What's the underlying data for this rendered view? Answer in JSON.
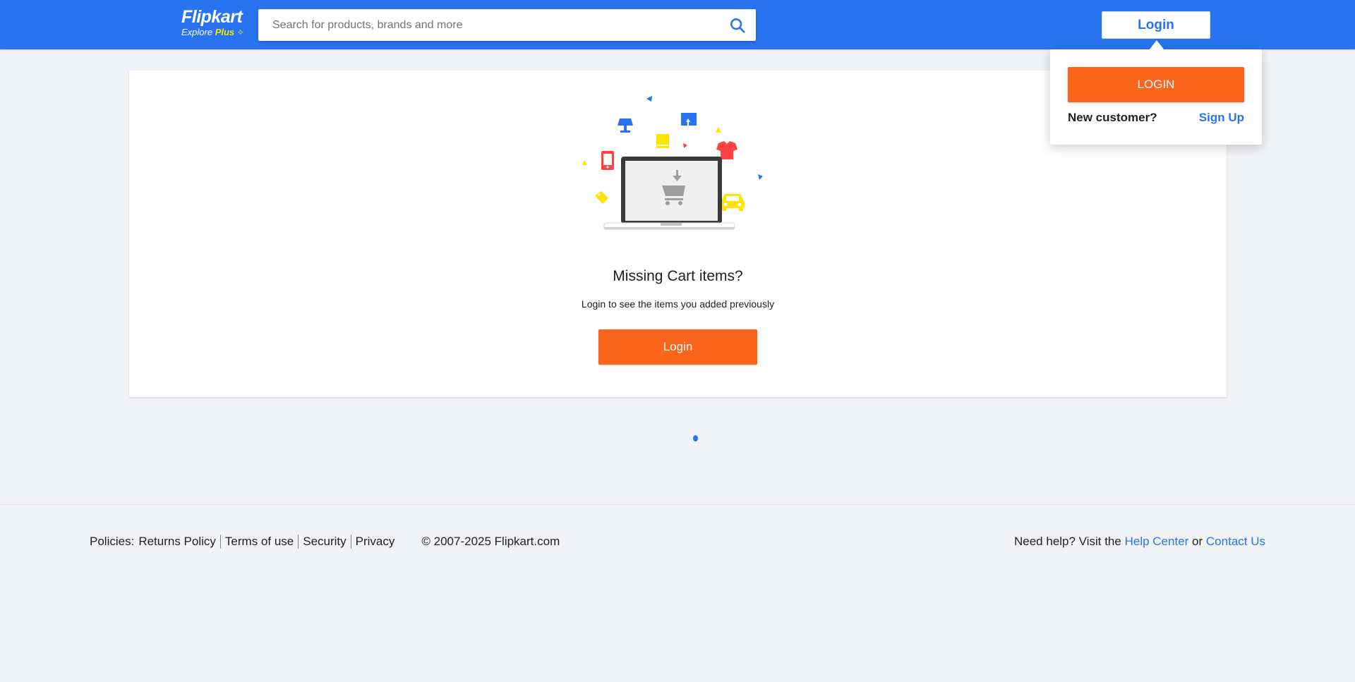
{
  "header": {
    "logo_text": "Flipkart",
    "logo_sub_prefix": "Explore",
    "logo_sub_plus": "Plus",
    "search_placeholder": "Search for products, brands and more",
    "login_label": "Login"
  },
  "login_dropdown": {
    "login_button": "LOGIN",
    "new_customer": "New customer?",
    "signup_link": "Sign Up"
  },
  "cart": {
    "title": "Missing Cart items?",
    "subtitle": "Login to see the items you added previously",
    "login_button": "Login"
  },
  "footer": {
    "policies_label": "Policies:",
    "links": [
      "Returns Policy",
      "Terms of use",
      "Security",
      "Privacy"
    ],
    "copyright": "© 2007-2025 Flipkart.com",
    "help_prefix": "Need help? Visit the",
    "help_center": "Help Center",
    "or": "or",
    "contact_us": "Contact Us"
  },
  "colors": {
    "brand_blue": "#2874f0",
    "accent_orange": "#fb641b",
    "plus_yellow": "#ffe500",
    "page_bg": "#f1f3f6"
  },
  "icons": [
    "search-icon",
    "laptop-cart-illustration",
    "loader-dot"
  ]
}
